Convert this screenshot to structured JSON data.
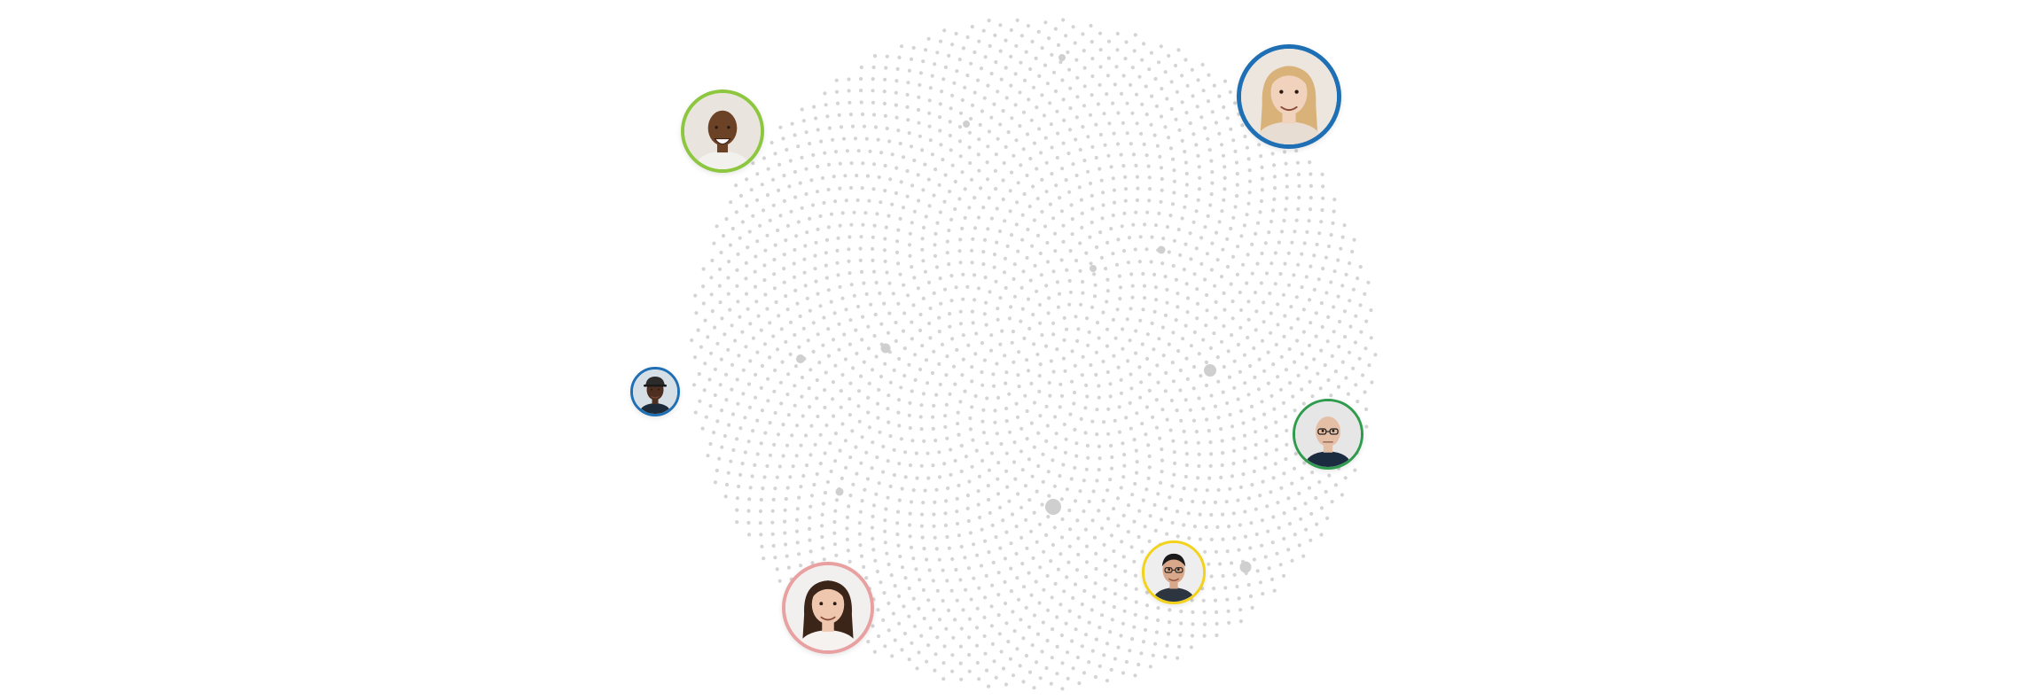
{
  "background_color": "#ffffff",
  "dot_color": "#d4d4d4",
  "avatars": [
    {
      "ring_color": "#8dc63f",
      "icon": "smiling-man-icon"
    },
    {
      "ring_color": "#1f6fb4",
      "icon": "smiling-woman-icon"
    },
    {
      "ring_color": "#1f6fb4",
      "icon": "man-with-cap-icon"
    },
    {
      "ring_color": "#2e9b4d",
      "icon": "older-man-with-glasses-icon"
    },
    {
      "ring_color": "#f2d21a",
      "icon": "man-with-glasses-icon"
    },
    {
      "ring_color": "#e8a0a0",
      "icon": "smiling-woman-icon"
    }
  ]
}
